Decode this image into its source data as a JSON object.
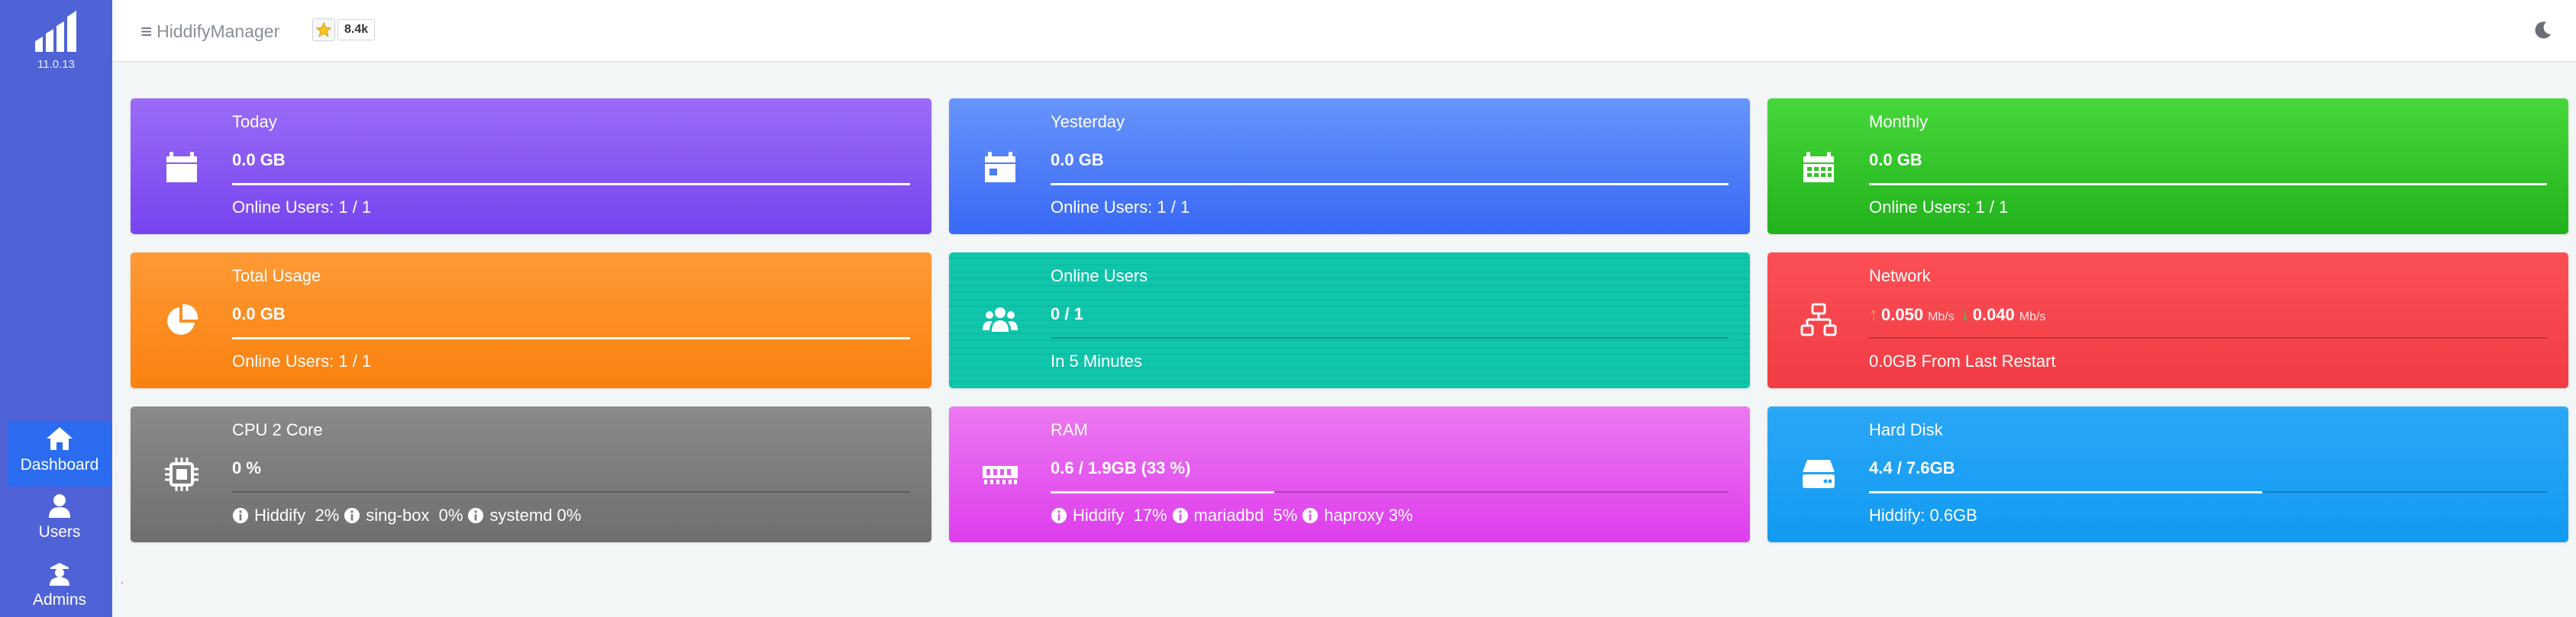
{
  "app": {
    "version": "11.0.13",
    "brand": "HiddifyManager",
    "star_count": "8.4k"
  },
  "sidebar": {
    "items": [
      {
        "label": "Dashboard",
        "icon": "home-icon",
        "active": true
      },
      {
        "label": "Users",
        "icon": "user-icon",
        "active": false
      },
      {
        "label": "Admins",
        "icon": "admin-icon",
        "active": false
      }
    ]
  },
  "cards": {
    "today": {
      "title": "Today",
      "value": "0.0 GB",
      "footer": "Online Users: 1 / 1",
      "icon": "calendar-day-icon",
      "progress": 1.0,
      "color": "#8458f3"
    },
    "yesterday": {
      "title": "Yesterday",
      "value": "0.0 GB",
      "footer": "Online Users: 1 / 1",
      "icon": "calendar-icon",
      "progress": 1.0,
      "color": "#4a7cf8"
    },
    "monthly": {
      "title": "Monthly",
      "value": "0.0 GB",
      "footer": "Online Users: 1 / 1",
      "icon": "calendar-month-icon",
      "progress": 1.0,
      "color": "#30c528"
    },
    "total": {
      "title": "Total Usage",
      "value": "0.0 GB",
      "footer": "Online Users: 1 / 1",
      "icon": "pie-chart-icon",
      "progress": 1.0,
      "color": "#fc8b21"
    },
    "online": {
      "title": "Online Users",
      "value": "0 / 1",
      "footer": "In 5 Minutes",
      "icon": "users-icon",
      "progress": 0.0,
      "color": "#0ebfa5"
    },
    "network": {
      "title": "Network",
      "up_value": "0.050",
      "up_unit": "Mb/s",
      "down_value": "0.040",
      "down_unit": "Mb/s",
      "up_arrow": "↑",
      "down_arrow": "↓",
      "footer": "0.0GB From Last Restart",
      "icon": "network-icon",
      "progress": 0.0,
      "color": "#f7454c"
    },
    "cpu": {
      "title": "CPU 2 Core",
      "value": "0 %",
      "icon": "cpu-icon",
      "progress": 0.0,
      "color": "#7c7c7c",
      "processes": [
        {
          "name": "Hiddify",
          "usage": "2%"
        },
        {
          "name": "sing-box",
          "usage": "0%"
        },
        {
          "name": "systemd",
          "usage": "0%"
        }
      ]
    },
    "ram": {
      "title": "RAM",
      "value": "0.6 / 1.9GB (33 %)",
      "icon": "memory-icon",
      "progress": 0.33,
      "color": "#e45bef",
      "processes": [
        {
          "name": "Hiddify",
          "usage": "17%"
        },
        {
          "name": "mariadbd",
          "usage": "5%"
        },
        {
          "name": "haproxy",
          "usage": "3%"
        }
      ]
    },
    "disk": {
      "title": "Hard Disk",
      "value": "4.4 / 7.6GB",
      "footer": "Hiddify: 0.6GB",
      "icon": "hard-drive-icon",
      "progress": 0.58,
      "color": "#1da1f4"
    }
  },
  "footer_mark": "."
}
